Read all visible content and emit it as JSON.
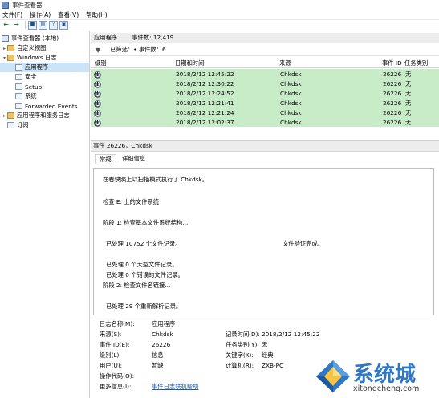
{
  "window": {
    "title": "事件查看器"
  },
  "menu": [
    "文件(F)",
    "操作(A)",
    "查看(V)",
    "帮助(H)"
  ],
  "toolbar": {
    "icons": [
      "back-arrow-icon",
      "forward-arrow-icon",
      "folder-icon",
      "properties-icon",
      "help-icon",
      "console-icon"
    ],
    "help_glyph": "?"
  },
  "tree": {
    "root": "事件查看器 (本地)",
    "custom_views": "自定义视图",
    "windows_logs": "Windows 日志",
    "logs": [
      "应用程序",
      "安全",
      "Setup",
      "系统",
      "Forwarded Events"
    ],
    "app_service_logs": "应用程序和服务日志",
    "subscriptions": "订阅"
  },
  "list": {
    "name": "应用程序",
    "count_label": "事件数: 12,419",
    "filter_text": "已筛选：• 事件数：6",
    "columns": [
      "级别",
      "日期和时间",
      "来源",
      "事件 ID",
      "任务类别"
    ],
    "rows": [
      {
        "level": "信息",
        "datetime": "2018/2/12 12:45:22",
        "source": "Chkdsk",
        "event_id": "26226",
        "category": "无"
      },
      {
        "level": "信息",
        "datetime": "2018/2/12 12:30:22",
        "source": "Chkdsk",
        "event_id": "26226",
        "category": "无"
      },
      {
        "level": "信息",
        "datetime": "2018/2/12 12:24:52",
        "source": "Chkdsk",
        "event_id": "26226",
        "category": "无"
      },
      {
        "level": "信息",
        "datetime": "2018/2/12 12:21:41",
        "source": "Chkdsk",
        "event_id": "26226",
        "category": "无"
      },
      {
        "level": "信息",
        "datetime": "2018/2/12 12:21:24",
        "source": "Chkdsk",
        "event_id": "26226",
        "category": "无"
      },
      {
        "level": "信息",
        "datetime": "2018/2/12 12:02:37",
        "source": "Chkdsk",
        "event_id": "26226",
        "category": "无"
      }
    ],
    "row_color": "#c9ecc8"
  },
  "detail": {
    "header": "事件 26226，Chkdsk",
    "tabs": [
      "常规",
      "详细信息"
    ],
    "description_lines": [
      "在卷快照上以扫描模式执行了 Chkdsk。",
      "检查 E: 上的文件系统",
      "阶段 1: 检查基本文件系统结构...",
      "已处理 10752 个文件记录。",
      "文件验证完成。",
      "已处理 0 个大型文件记录。",
      "已处理 0 个错误的文件记录。",
      "阶段 2: 检查文件名链接...",
      "已处理 29 个重新解析记录。"
    ],
    "props": {
      "log_name_k": "日志名称(M):",
      "log_name_v": "应用程序",
      "source_k": "来源(S):",
      "source_v": "Chkdsk",
      "logged_k": "记录时间(D):",
      "logged_v": "2018/2/12 12:45:22",
      "eventid_k": "事件 ID(E):",
      "eventid_v": "26226",
      "task_k": "任务类别(Y):",
      "task_v": "无",
      "level_k": "级别(L):",
      "level_v": "信息",
      "keywords_k": "关键字(K):",
      "keywords_v": "经典",
      "user_k": "用户(U):",
      "user_v": "暂缺",
      "computer_k": "计算机(R):",
      "computer_v": "ZXB-PC",
      "opcode_k": "操作代码(O):",
      "moreinfo_k": "更多信息(I):",
      "moreinfo_link": "事件日志联机帮助"
    }
  },
  "watermark": {
    "brand": "系统城",
    "site": "xitongcheng.com"
  }
}
